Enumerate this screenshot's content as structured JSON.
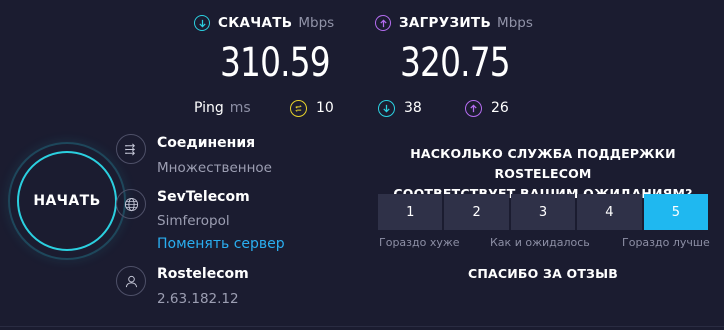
{
  "download": {
    "label": "СКАЧАТЬ",
    "unit": "Mbps",
    "value": "310.59",
    "color": "#2bd0e0",
    "icon": "arrow-down-circle-icon"
  },
  "upload": {
    "label": "ЗАГРУЗИТЬ",
    "unit": "Mbps",
    "value": "320.75",
    "color": "#b46cf0",
    "icon": "arrow-up-circle-icon"
  },
  "ping": {
    "label": "Ping",
    "unit": "ms",
    "jitter": {
      "value": "10",
      "color": "#e6d12a",
      "icon": "jitter-icon"
    },
    "download": {
      "value": "38",
      "color": "#2bd0e0",
      "icon": "arrow-down-circle-icon"
    },
    "upload": {
      "value": "26",
      "color": "#b46cf0",
      "icon": "arrow-up-circle-icon"
    }
  },
  "go_button": {
    "label": "НАЧАТЬ",
    "color": "#2bd0e0"
  },
  "connections": {
    "title": "Соединения",
    "value": "Множественное",
    "icon": "connections-icon"
  },
  "server": {
    "title": "SevTelecom",
    "location": "Simferopol",
    "change_link": "Поменять сервер",
    "icon": "globe-icon"
  },
  "provider": {
    "title": "Rostelecom",
    "ip": "2.63.182.12",
    "icon": "user-icon"
  },
  "survey": {
    "question_line1": "НАСКОЛЬКО СЛУЖБА ПОДДЕРЖКИ ROSTELECOM",
    "question_line2": "СООТВЕТСТВУЕТ ВАШИМ ОЖИДАНИЯМ?",
    "ratings": [
      "1",
      "2",
      "3",
      "4",
      "5"
    ],
    "selected": "5",
    "selected_color": "#1fb8f0",
    "label_low": "Гораздо хуже",
    "label_mid": "Как и ожидалось",
    "label_high": "Гораздо лучше",
    "thanks": "СПАСИБО ЗА ОТЗЫВ"
  }
}
